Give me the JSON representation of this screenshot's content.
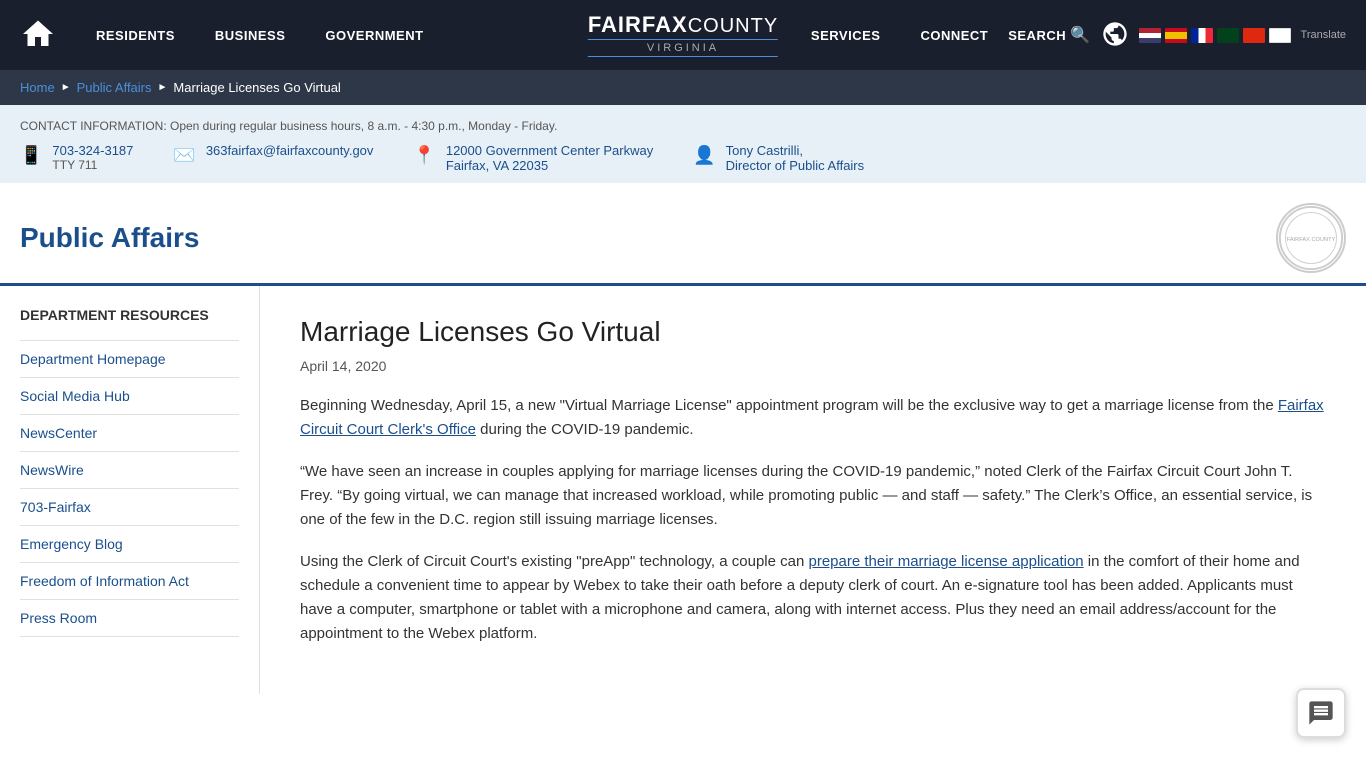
{
  "header": {
    "home_label": "Home",
    "nav": [
      {
        "label": "RESIDENTS",
        "id": "residents"
      },
      {
        "label": "BUSINESS",
        "id": "business"
      },
      {
        "label": "GOVERNMENT",
        "id": "government"
      },
      {
        "label": "SERVICES",
        "id": "services"
      },
      {
        "label": "CONNECT",
        "id": "connect"
      }
    ],
    "logo_fairfax": "FAIRFAX",
    "logo_county": "COUNTY",
    "logo_virginia": "VIRGINIA",
    "search_label": "SEARCH",
    "translate_label": "Translate"
  },
  "breadcrumb": {
    "home": "Home",
    "parent": "Public Affairs",
    "current": "Marriage Licenses Go Virtual"
  },
  "contact_bar": {
    "info_text": "CONTACT INFORMATION: Open during regular business hours, 8 a.m. - 4:30 p.m., Monday - Friday.",
    "phone": "703-324-3187",
    "tty": "TTY 711",
    "email": "363fairfax@fairfaxcounty.gov",
    "address_line1": "12000 Government Center Parkway",
    "address_line2": "Fairfax, VA 22035",
    "director_name": "Tony Castrilli,",
    "director_title": "Director of Public Affairs"
  },
  "page": {
    "title": "Public Affairs"
  },
  "sidebar": {
    "heading": "DEPARTMENT RESOURCES",
    "links": [
      {
        "label": "Department Homepage",
        "id": "dept-homepage"
      },
      {
        "label": "Social Media Hub",
        "id": "social-media"
      },
      {
        "label": "NewsCenter",
        "id": "newscenter"
      },
      {
        "label": "NewsWire",
        "id": "newswire"
      },
      {
        "label": "703-Fairfax",
        "id": "703-fairfax"
      },
      {
        "label": "Emergency Blog",
        "id": "emergency-blog"
      },
      {
        "label": "Freedom of Information Act",
        "id": "foia"
      },
      {
        "label": "Press Room",
        "id": "press-room"
      }
    ]
  },
  "article": {
    "title": "Marriage Licenses Go Virtual",
    "date": "April 14, 2020",
    "body": [
      "Beginning Wednesday, April 15, a new “Virtual Marriage License” appointment program will be the exclusive way to get a marriage license from the Fairfax Circuit Court Clerk’s Office during the COVID-19 pandemic.",
      "“We have seen an increase in couples applying for marriage licenses during the COVID-19 pandemic,” noted Clerk of the Fairfax Circuit Court John T. Frey. “By going virtual, we can manage that increased workload, while promoting public — and staff — safety.” The Clerk’s Office, an essential service, is one of the few in the D.C. region still issuing marriage licenses.",
      "Using the Clerk of Circuit Court’s existing “preApp” technology, a couple can prepare their marriage license application in the comfort of their home and schedule a convenient time to appear by Webex to take their oath before a deputy clerk of court. An e-signature tool has been added. Applicants must have a computer, smartphone or tablet with a microphone and camera, along with internet access. Plus they need an email address/account for the appointment to the Webex platform."
    ],
    "link1_text": "Fairfax Circuit Court Clerk's Office",
    "link2_text": "prepare their marriage license application"
  }
}
